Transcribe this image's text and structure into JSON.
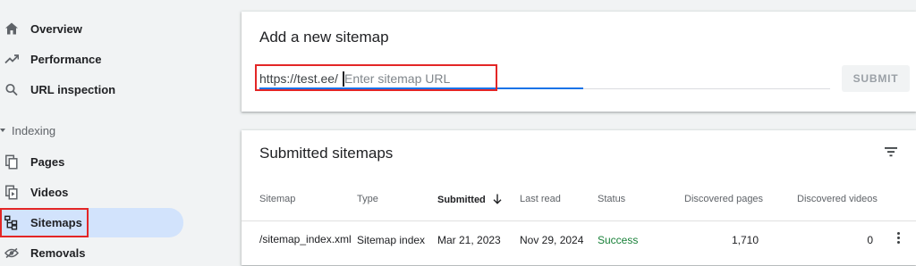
{
  "sidebar": {
    "items": [
      {
        "label": "Overview",
        "icon": "home-icon"
      },
      {
        "label": "Performance",
        "icon": "trending-up-icon"
      },
      {
        "label": "URL inspection",
        "icon": "search-icon"
      }
    ],
    "section": "Indexing",
    "indexing_items": [
      {
        "label": "Pages",
        "icon": "pages-icon"
      },
      {
        "label": "Videos",
        "icon": "videos-icon"
      },
      {
        "label": "Sitemaps",
        "icon": "sitemap-icon",
        "active": true
      },
      {
        "label": "Removals",
        "icon": "removals-icon"
      }
    ]
  },
  "add_sitemap": {
    "title": "Add a new sitemap",
    "url_prefix": "https://test.ee/",
    "placeholder": "Enter sitemap URL",
    "value": "",
    "submit_label": "SUBMIT"
  },
  "submitted": {
    "title": "Submitted sitemaps",
    "columns": {
      "sitemap": "Sitemap",
      "type": "Type",
      "submitted": "Submitted",
      "last_read": "Last read",
      "status": "Status",
      "discovered_pages": "Discovered pages",
      "discovered_videos": "Discovered videos"
    },
    "rows": [
      {
        "sitemap": "/sitemap_index.xml",
        "type": "Sitemap index",
        "submitted": "Mar 21, 2023",
        "last_read": "Nov 29, 2024",
        "status": "Success",
        "discovered_pages": "1,710",
        "discovered_videos": "0"
      }
    ]
  },
  "colors": {
    "accent": "#1a73e8",
    "active_bg": "#d2e3fc",
    "success": "#188038",
    "highlight": "#e32626"
  }
}
